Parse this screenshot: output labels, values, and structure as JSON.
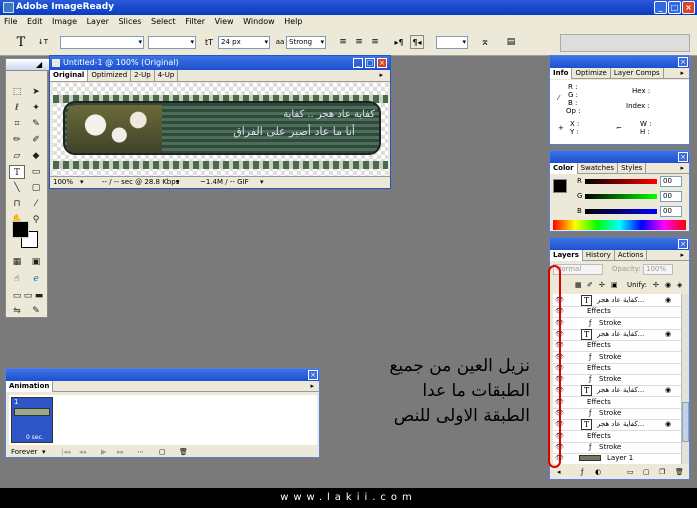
{
  "app": {
    "title": "Adobe ImageReady"
  },
  "menu": [
    "File",
    "Edit",
    "Image",
    "Layer",
    "Slices",
    "Select",
    "Filter",
    "View",
    "Window",
    "Help"
  ],
  "options": {
    "font_size": "24 px",
    "antialias": "Strong"
  },
  "document": {
    "title": "Untitled-1 @ 100% (Original)",
    "tabs": [
      "Original",
      "Optimized",
      "2-Up",
      "4-Up"
    ],
    "banner_text_1": "كفاية عاد هجر .. كفاية",
    "banner_text_2": "أنا ما عاد أصبر على الفراق",
    "zoom": "100%",
    "speed": "-- / -- sec @ 28.8 Kbps",
    "size": "~1.4M / -- GIF"
  },
  "info_panel": {
    "tabs": [
      "Info",
      "Optimize",
      "Layer Comps"
    ],
    "r": "R :",
    "g": "G :",
    "b": "B :",
    "op": "Op :",
    "hex": "Hex :",
    "index": "Index :",
    "x": "X :",
    "y": "Y :",
    "w": "W :",
    "h": "H :"
  },
  "color_panel": {
    "tabs": [
      "Color",
      "Swatches",
      "Styles"
    ],
    "r_label": "R",
    "g_label": "G",
    "b_label": "B",
    "r_val": "00",
    "g_val": "00",
    "b_val": "00"
  },
  "layers_panel": {
    "tabs": [
      "Layers",
      "History",
      "Actions"
    ],
    "blend": "Normal",
    "opacity_label": "Opacity:",
    "opacity": "100%",
    "unify": "Unify:",
    "rows": [
      {
        "kind": "text",
        "label": "كفاية عاد هجر..."
      },
      {
        "kind": "effects",
        "label": "Effects"
      },
      {
        "kind": "stroke",
        "label": "Stroke"
      },
      {
        "kind": "text",
        "label": "كفاية عاد هجر..."
      },
      {
        "kind": "effects",
        "label": "Effects"
      },
      {
        "kind": "stroke",
        "label": "Stroke"
      },
      {
        "kind": "effects",
        "label": "Effects"
      },
      {
        "kind": "stroke",
        "label": "Stroke"
      },
      {
        "kind": "text",
        "label": "كفاية عاد هجر..."
      },
      {
        "kind": "effects",
        "label": "Effects"
      },
      {
        "kind": "stroke",
        "label": "Stroke"
      },
      {
        "kind": "text",
        "label": "كفاية عاد هجر..."
      },
      {
        "kind": "effects",
        "label": "Effects"
      },
      {
        "kind": "stroke",
        "label": "Stroke"
      },
      {
        "kind": "layer",
        "label": "Layer 1"
      }
    ]
  },
  "animation": {
    "title": "Animation",
    "frame_number": "1",
    "frame_delay": "0 sec.",
    "loop": "Forever"
  },
  "instruction": {
    "line1": "نزيل العين من جميع",
    "line2": "الطبقات ما عدا",
    "line3": "الطبقة الاولى للنص"
  },
  "footer": {
    "text": "www.lakii.com"
  },
  "colors": {
    "title_blue": "#1d4fd0",
    "panel_bg": "#ece9d8",
    "highlight": "#ff0000"
  }
}
